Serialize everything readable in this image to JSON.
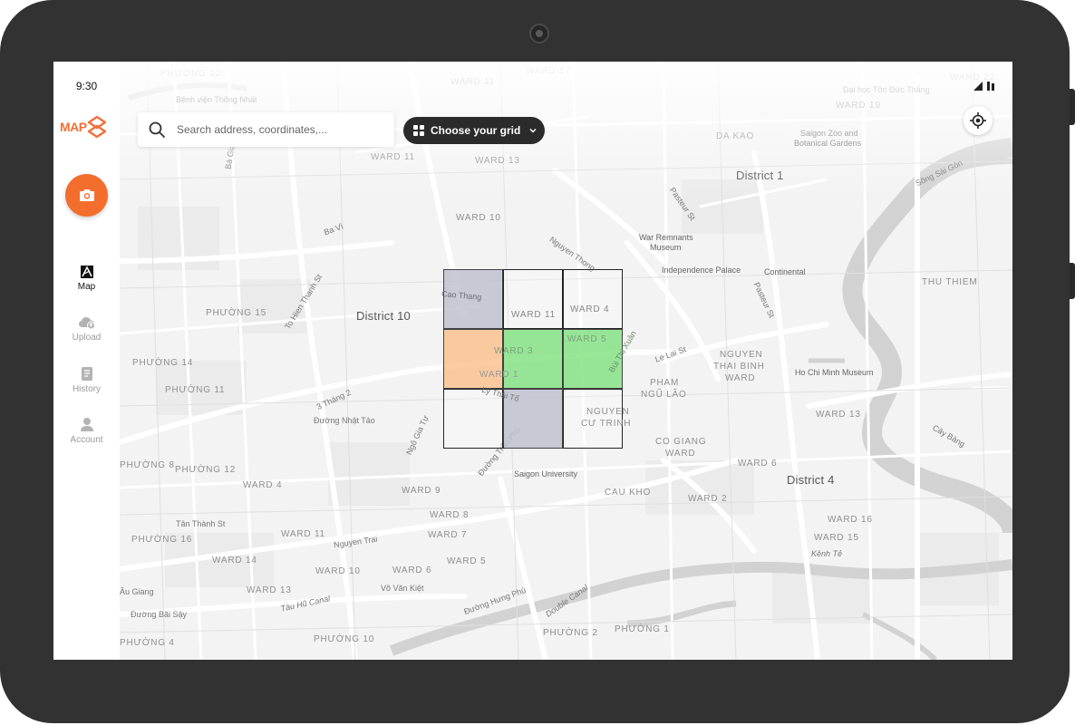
{
  "status_bar": {
    "time": "9:30"
  },
  "app": {
    "logo_text": "MAP",
    "accent_color": "#f36d2d"
  },
  "sidebar": {
    "camera_icon": "camera-icon",
    "items": [
      {
        "label": "Map",
        "icon": "map-icon",
        "active": true
      },
      {
        "label": "Upload",
        "icon": "cloud-upload-icon",
        "active": false
      },
      {
        "label": "History",
        "icon": "history-icon",
        "active": false
      },
      {
        "label": "Account",
        "icon": "account-icon",
        "active": false
      }
    ]
  },
  "search": {
    "placeholder": "Search address, coordinates,..."
  },
  "grid_selector": {
    "label": "Choose your grid",
    "icon": "grid-icon"
  },
  "grid": {
    "cells": [
      {
        "color": "#c2c2d2",
        "state": "grey"
      },
      {
        "color": "none",
        "state": "empty"
      },
      {
        "color": "none",
        "state": "empty"
      },
      {
        "color": "#fbc391",
        "state": "orange"
      },
      {
        "color": "#86e386",
        "state": "green"
      },
      {
        "color": "#86e386",
        "state": "green"
      },
      {
        "color": "none",
        "state": "empty"
      },
      {
        "color": "#c2c2d2",
        "state": "grey"
      },
      {
        "color": "none",
        "state": "empty"
      }
    ]
  },
  "map_labels": {
    "phuong_12_top": "PHƯỜNG 12",
    "benh_vien": "Bệnh viện Thống Nhất",
    "ward_17": "WARD 17",
    "ward_11_top": "WARD 11",
    "ward_22": "WARD 22",
    "dai_hoc": "Đại học Tôn Đức Thắng",
    "ward_19": "WARD 19",
    "da_kao": "DA KAO",
    "saigon_zoo": "Saigon Zoo and",
    "botanical": "Botanical Gardens",
    "district_1": "District 1",
    "ward_11_b": "WARD 11",
    "ward_13_a": "WARD 13",
    "ba_gia": "Bà Gia",
    "ward_10_a": "WARD 10",
    "pasteur_a": "Pasteur St",
    "song_sai_gon": "Sông Sài Gòn",
    "ba_vi": "Ba Vì",
    "nguyen_thong": "Nguyen Thong",
    "war_remnants": "War Remnants",
    "museum": "Museum",
    "independence": "Independence Palace",
    "continental": "Continental",
    "thu_thiem": "THU THIEM",
    "to_hien_thanh": "To Hien Thanh St",
    "cao_thang": "Cao Thang",
    "phuong_15": "PHƯỜNG 15",
    "district_10": "District 10",
    "ward_11_grid": "WARD 11",
    "ward_4_grid": "WARD 4",
    "pasteur_b": "Pasteur St",
    "ward_3": "WARD 3",
    "ward_5_grid": "WARD 5",
    "bui_thi_xuan": "Bùi Thị Xuân",
    "le_lai": "Le Lai St",
    "nguyen_thai_binh_1": "NGUYEN",
    "nguyen_thai_binh_2": "THAI BINH",
    "nguyen_thai_binh_3": "WARD",
    "phuong_14": "PHƯỜNG 14",
    "ward_1": "WARD 1",
    "ho_chi_minh_museum": "Ho Chi Minh Museum",
    "pham_ngu_lao_1": "PHAM",
    "pham_ngu_lao_2": "NGŨ LÃO",
    "phuong_11": "PHƯỜNG 11",
    "ly_thai_to": "Lý Thái Tổ",
    "ward_13_b": "WARD 13",
    "three_thang_2": "3 Tháng 2",
    "nguyen_cu_trinh_1": "NGUYEN",
    "nguyen_cu_trinh_2": "CƯ TRINH",
    "duong_nhat_tao": "Đường Nhật Tảo",
    "ngo_gia_tu": "Ngô Gia Tự",
    "duong_tran_phu": "Đường Trần Phú",
    "cay_bang": "Cây Bàng",
    "co_giang_1": "CO GIANG",
    "co_giang_2": "WARD",
    "phuong_8": "PHƯỜNG 8",
    "phuong_12_b": "PHƯỜNG 12",
    "ward_6_a": "WARD 6",
    "saigon_university": "Saigon University",
    "district_4": "District 4",
    "ward_4_b": "WARD 4",
    "ward_9": "WARD 9",
    "cau_kho": "CAU KHO",
    "ward_2": "WARD 2",
    "tan_thanh": "Tân Thành St",
    "ward_8": "WARD 8",
    "ward_16": "WARD 16",
    "phuong_16": "PHƯỜNG 16",
    "ward_11_c": "WARD 11",
    "nguyen_trai": "Nguyen Trai",
    "ward_7": "WARD 7",
    "ward_15": "WARD 15",
    "ward_14": "WARD 14",
    "ward_5_b": "WARD 5",
    "kenh_te": "Kênh Tẻ",
    "ward_10_b": "WARD 10",
    "ward_6_b": "WARD 6",
    "vo_van_kiet": "Võ Văn Kiệt",
    "au_giang": "Âu Giang",
    "ward_13_c": "WARD 13",
    "tau_hu": "Tàu Hũ Canal",
    "duong_hung_phu": "Đường Hưng Phú",
    "double_canal": "Double Canal",
    "duong_bai_say": "Đường Bãi Sậy",
    "phuong_4": "PHƯỜNG 4",
    "phuong_10": "PHƯỜNG 10",
    "phuong_2": "PHƯỜNG 2",
    "phuong_1": "PHƯỜNG 1"
  }
}
